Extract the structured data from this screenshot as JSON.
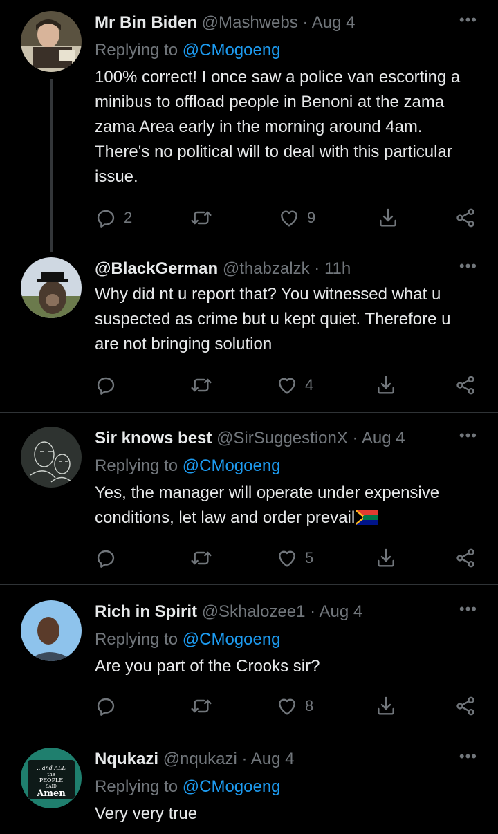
{
  "tweets": [
    {
      "name": "Mr Bin Biden",
      "handle": "@Mashwebs",
      "time": "Aug 4",
      "replying_label": "Replying to",
      "replying_to": "@CMogoeng",
      "text": "100% correct! I once saw a police van escorting a minibus to offload people in Benoni at the zama zama Area early in the morning around 4am. There's no political will to deal with this particular issue.",
      "reply_count": "2",
      "retweet_count": "",
      "like_count": "9"
    },
    {
      "name": "@BlackGerman",
      "handle": "@thabzalzk",
      "time": "11h",
      "text": "Why did nt u report that? You witnessed what u suspected as crime but u kept quiet. Therefore u are not bringing solution",
      "reply_count": "",
      "retweet_count": "",
      "like_count": "4"
    },
    {
      "name": "Sir knows best",
      "handle": "@SirSuggestionX",
      "time": "Aug 4",
      "replying_label": "Replying to",
      "replying_to": "@CMogoeng",
      "text": "Yes, the manager will operate under expensive conditions, let law and order prevail",
      "reply_count": "",
      "retweet_count": "",
      "like_count": "5"
    },
    {
      "name": "Rich in Spirit",
      "handle": "@Skhalozee1",
      "time": "Aug 4",
      "replying_label": "Replying to",
      "replying_to": "@CMogoeng",
      "text": "Are you part of the Crooks sir?",
      "reply_count": "",
      "retweet_count": "",
      "like_count": "8"
    },
    {
      "name": "Nqukazi",
      "handle": "@nqukazi",
      "time": "Aug 4",
      "replying_label": "Replying to",
      "replying_to": "@CMogoeng",
      "text": "Very very true"
    }
  ],
  "avatar_badge": {
    "line1": "...and ALL",
    "line2": "the",
    "line3": "PEOPLE",
    "line4": "SAID",
    "line5": "Amen"
  },
  "sep": "·",
  "more": "•••",
  "colors": {
    "background": "#000000",
    "text": "#e7e9ea",
    "muted": "#71767b",
    "link": "#1d9bf0",
    "divider": "#2f3336"
  }
}
